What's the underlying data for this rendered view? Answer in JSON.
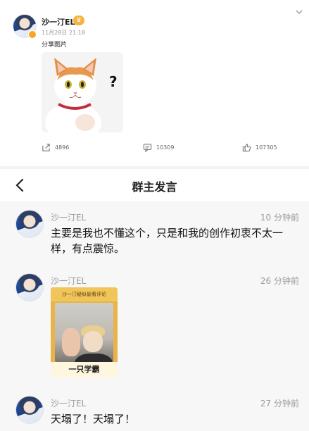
{
  "post": {
    "author": "沙一汀EL",
    "timestamp": "11月28日 21:18",
    "text": "分享图片",
    "image_caption_mark": "?",
    "actions": {
      "share_count": "4896",
      "comment_count": "10309",
      "like_count": "107305"
    }
  },
  "group_chat": {
    "title": "群主发言",
    "messages": [
      {
        "author": "沙一汀EL",
        "time": "10 分钟前",
        "text": "主要是我也不懂这个，只是和我的创作初衷不太一样，有点震惊。"
      },
      {
        "author": "沙一汀EL",
        "time": "26 分钟前",
        "sticker_top_text": "沙一汀疑似偷看评论",
        "sticker_bottom_text": "一只学霸"
      },
      {
        "author": "沙一汀EL",
        "time": "27 分钟前",
        "text": "天塌了！天塌了！"
      }
    ]
  },
  "colors": {
    "accent_orange": "#f5a623",
    "muted_text": "#9a9a9a",
    "chat_background": "#f7f7f7"
  }
}
